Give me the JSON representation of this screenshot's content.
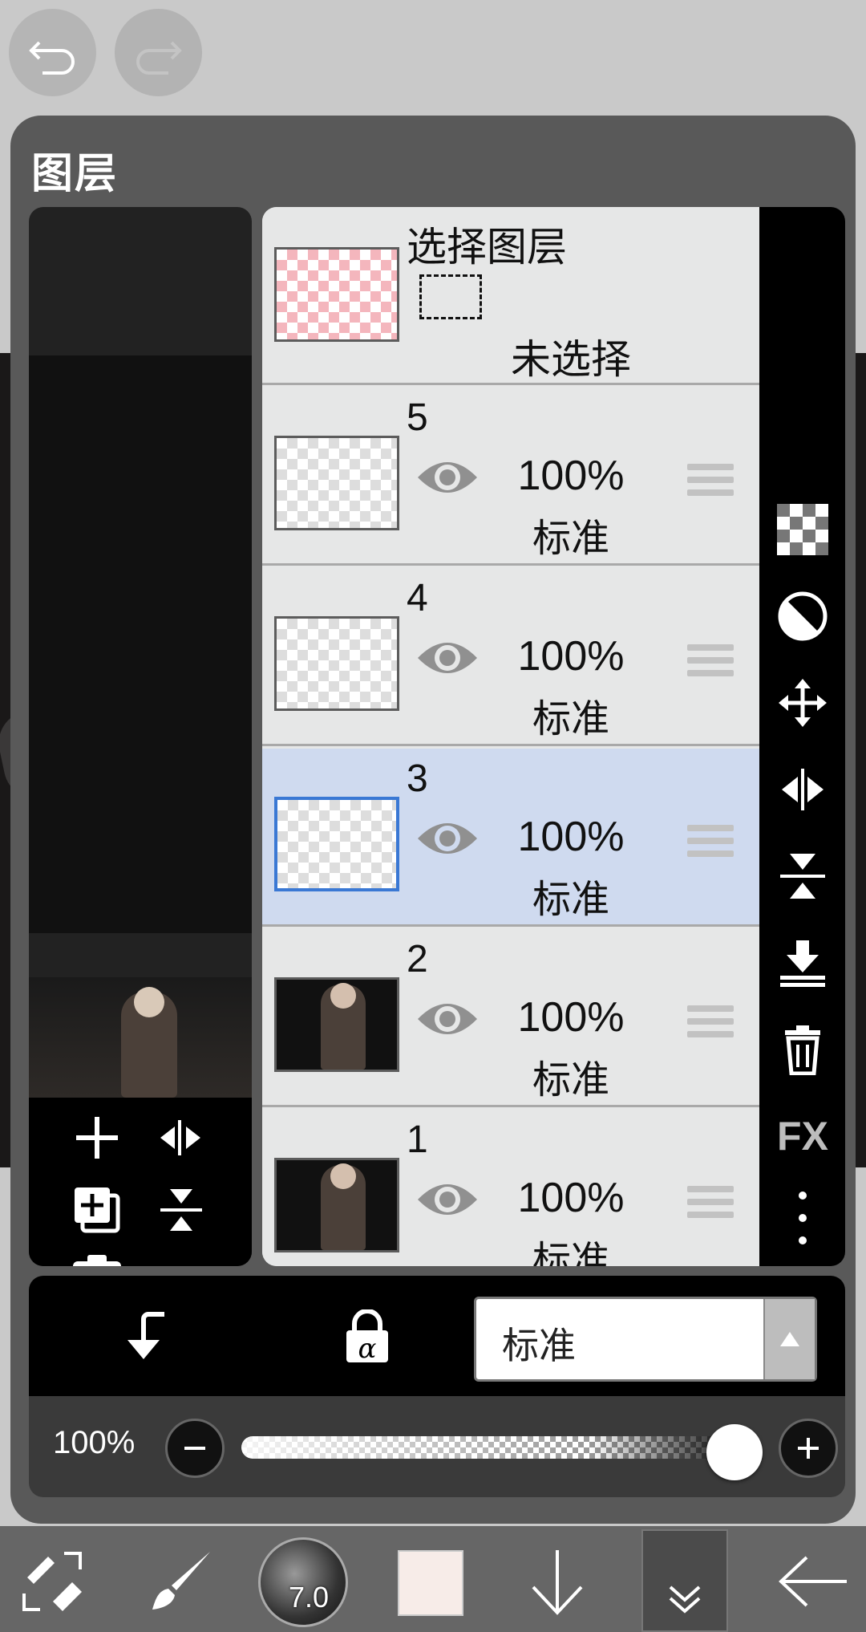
{
  "panel": {
    "title": "图层"
  },
  "select_layer": {
    "title": "选择图层",
    "status": "未选择"
  },
  "layers": [
    {
      "number": "5",
      "opacity": "100%",
      "blend": "标准"
    },
    {
      "number": "4",
      "opacity": "100%",
      "blend": "标准"
    },
    {
      "number": "3",
      "opacity": "100%",
      "blend": "标准"
    },
    {
      "number": "2",
      "opacity": "100%",
      "blend": "标准"
    },
    {
      "number": "1",
      "opacity": "100%",
      "blend": "标准"
    }
  ],
  "selected_layer": "3",
  "right_toolbar": {
    "fx_label": "FX"
  },
  "blend_mode": {
    "value": "标准"
  },
  "opacity_slider": {
    "label": "100%",
    "value": 1.0
  },
  "brush": {
    "size": "7.0"
  },
  "colors": {
    "selected_row": "#cfdaef",
    "panel_bg": "#595959",
    "current_color": "#f7ece8"
  }
}
